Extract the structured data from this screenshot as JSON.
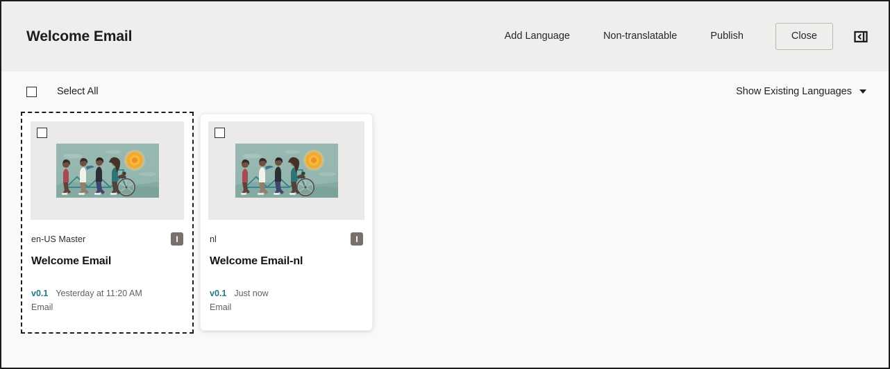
{
  "header": {
    "title": "Welcome Email",
    "actions": [
      {
        "id": "add-language",
        "label": "Add Language"
      },
      {
        "id": "non-translatable",
        "label": "Non-translatable"
      },
      {
        "id": "publish",
        "label": "Publish"
      }
    ],
    "close_label": "Close",
    "panel_toggle_icon": "collapse-panel-left-icon"
  },
  "toolbar": {
    "select_all_label": "Select All",
    "select_all_checked": false,
    "filter_label": "Show Existing Languages",
    "filter_caret_icon": "chevron-down-icon"
  },
  "colors": {
    "header_bg": "#efeeec",
    "body_bg": "#faf9f7",
    "accent_link": "#1f7a8c",
    "badge_bg": "#78706c",
    "frame_border": "#1a1a1a"
  },
  "cards": [
    {
      "id": "card-en-us",
      "selected": true,
      "checkbox_checked": false,
      "locale": "en-US  Master",
      "title": "Welcome Email",
      "badge": "I",
      "version": "v0.1",
      "timestamp": "Yesterday at 11:20 AM",
      "doctype": "Email",
      "thumbnail_alt": "illustration-four-people-riding-tandem-bicycle-with-sun"
    },
    {
      "id": "card-nl",
      "selected": false,
      "checkbox_checked": false,
      "locale": "nl",
      "title": "Welcome Email-nl",
      "badge": "I",
      "version": "v0.1",
      "timestamp": "Just now",
      "doctype": "Email",
      "thumbnail_alt": "illustration-four-people-riding-tandem-bicycle-with-sun"
    }
  ]
}
